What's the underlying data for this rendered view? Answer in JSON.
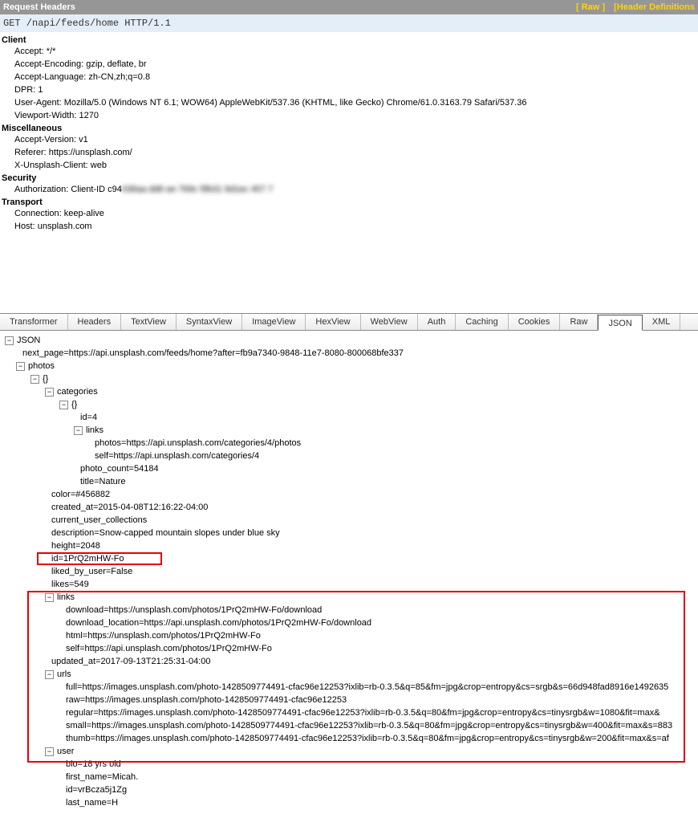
{
  "header": {
    "title": "Request Headers",
    "link_raw": "[ Raw ]",
    "link_defs": "[Header Definitions"
  },
  "request_line": "GET /napi/feeds/home HTTP/1.1",
  "groups": {
    "client": {
      "title": "Client",
      "items": {
        "accept": "Accept: */*",
        "accept_encoding": "Accept-Encoding: gzip, deflate, br",
        "accept_language": "Accept-Language: zh-CN,zh;q=0.8",
        "dpr": "DPR: 1",
        "user_agent": "User-Agent: Mozilla/5.0 (Windows NT 6.1; WOW64) AppleWebKit/537.36 (KHTML, like Gecko) Chrome/61.0.3163.79 Safari/537.36",
        "viewport_width": "Viewport-Width: 1270"
      }
    },
    "misc": {
      "title": "Miscellaneous",
      "items": {
        "accept_version": "Accept-Version: v1",
        "referer": "Referer: https://unsplash.com/",
        "x_client": "X-Unsplash-Client: web"
      }
    },
    "security": {
      "title": "Security",
      "items": {
        "auth_prefix": "Authorization: Client-ID c94",
        "auth_blur": "036aa  dd6  ee  769c  5fb31  9d1ec  457  7"
      }
    },
    "transport": {
      "title": "Transport",
      "items": {
        "connection": "Connection: keep-alive",
        "host": "Host: unsplash.com"
      }
    }
  },
  "tabs": {
    "transformer": "Transformer",
    "headers": "Headers",
    "textview": "TextView",
    "syntaxview": "SyntaxView",
    "imageview": "ImageView",
    "hexview": "HexView",
    "webview": "WebView",
    "auth": "Auth",
    "caching": "Caching",
    "cookies": "Cookies",
    "raw": "Raw",
    "json": "JSON",
    "xml": "XML"
  },
  "tree": {
    "root": "JSON",
    "next_page": "next_page=https://api.unsplash.com/feeds/home?after=fb9a7340-9848-11e7-8080-800068bfe337",
    "photos": "photos",
    "obj": "{}",
    "categories": "categories",
    "cat_obj": "{}",
    "cat_id": "id=4",
    "cat_links": "links",
    "cat_photos": "photos=https://api.unsplash.com/categories/4/photos",
    "cat_self": "self=https://api.unsplash.com/categories/4",
    "photo_count": "photo_count=54184",
    "cat_title": "title=Nature",
    "color": "color=#456882",
    "created_at": "created_at=2015-04-08T12:16:22-04:00",
    "cuc": "current_user_collections",
    "description": "description=Snow-capped mountain slopes under blue sky",
    "height": "height=2048",
    "id": "id=1PrQ2mHW-Fo",
    "liked": "liked_by_user=False",
    "likes": "likes=549",
    "links": "links",
    "l_download": "download=https://unsplash.com/photos/1PrQ2mHW-Fo/download",
    "l_dloc": "download_location=https://api.unsplash.com/photos/1PrQ2mHW-Fo/download",
    "l_html": "html=https://unsplash.com/photos/1PrQ2mHW-Fo",
    "l_self": "self=https://api.unsplash.com/photos/1PrQ2mHW-Fo",
    "updated_at": "updated_at=2017-09-13T21:25:31-04:00",
    "urls": "urls",
    "u_full": "full=https://images.unsplash.com/photo-1428509774491-cfac96e12253?ixlib=rb-0.3.5&q=85&fm=jpg&crop=entropy&cs=srgb&s=66d948fad8916e1492635",
    "u_raw": "raw=https://images.unsplash.com/photo-1428509774491-cfac96e12253",
    "u_regular": "regular=https://images.unsplash.com/photo-1428509774491-cfac96e12253?ixlib=rb-0.3.5&q=80&fm=jpg&crop=entropy&cs=tinysrgb&w=1080&fit=max&",
    "u_small": "small=https://images.unsplash.com/photo-1428509774491-cfac96e12253?ixlib=rb-0.3.5&q=80&fm=jpg&crop=entropy&cs=tinysrgb&w=400&fit=max&s=883",
    "u_thumb": "thumb=https://images.unsplash.com/photo-1428509774491-cfac96e12253?ixlib=rb-0.3.5&q=80&fm=jpg&crop=entropy&cs=tinysrgb&w=200&fit=max&s=af",
    "user": "user",
    "bio": "bio=18 yrs old",
    "first_name": "first_name=Micah.",
    "user_id": "id=vrBcza5j1Zg",
    "last_name": "last_name=H"
  }
}
